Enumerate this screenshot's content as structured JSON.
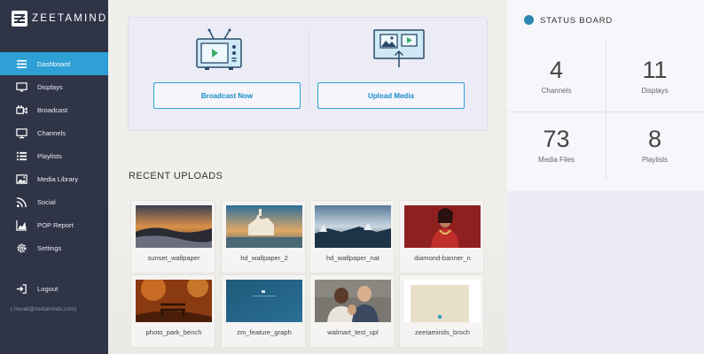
{
  "brand": {
    "name": "ZEETAMINDS"
  },
  "sidebar": {
    "items": [
      {
        "label": "Dashboard",
        "icon": "menu-icon",
        "active": true
      },
      {
        "label": "Displays",
        "icon": "monitor-icon"
      },
      {
        "label": "Broadcast",
        "icon": "video-camera-icon"
      },
      {
        "label": "Channels",
        "icon": "desktop-icon"
      },
      {
        "label": "Playlists",
        "icon": "list-icon"
      },
      {
        "label": "Media Library",
        "icon": "image-icon"
      },
      {
        "label": "Social",
        "icon": "rss-icon"
      },
      {
        "label": "POP Report",
        "icon": "bar-chart-icon"
      },
      {
        "label": "Settings",
        "icon": "gear-icon"
      }
    ],
    "logout_label": "Logout",
    "user_email": "( murali@zeetaminds.com)"
  },
  "actions": {
    "broadcast_label": "Broadcast Now",
    "upload_label": "Upload Media"
  },
  "recent": {
    "title": "RECENT UPLOADS",
    "items": [
      {
        "name": "sunset_wallpaper"
      },
      {
        "name": "hd_wallpaper_2"
      },
      {
        "name": "hd_wallpaper_nat"
      },
      {
        "name": "diamond-banner_n"
      },
      {
        "name": "photo_park_bench"
      },
      {
        "name": "zm_feature_graph"
      },
      {
        "name": "walmart_test_upl"
      },
      {
        "name": "zeetaminds_broch"
      }
    ]
  },
  "status": {
    "title": "STATUS BOARD",
    "stats": [
      {
        "value": "4",
        "label": "Channels"
      },
      {
        "value": "11",
        "label": "Displays"
      },
      {
        "value": "73",
        "label": "Media Files"
      },
      {
        "value": "8",
        "label": "Playlists"
      }
    ]
  },
  "colors": {
    "sidebar_bg": "#2f3547",
    "accent": "#2ea0d6",
    "status_dot": "#2f87b2"
  }
}
